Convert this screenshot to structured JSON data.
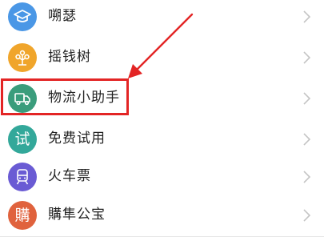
{
  "menu": {
    "items": [
      {
        "label": "嗍瑟",
        "icon": "graduation-cap-icon",
        "color": "#4a97e6"
      },
      {
        "label": "摇钱树",
        "icon": "money-tree-icon",
        "color": "#f0a52b"
      },
      {
        "label": "物流小助手",
        "icon": "delivery-truck-icon",
        "color": "#3a9d7c"
      },
      {
        "label": "免费试用",
        "icon": "trial-icon",
        "icon_text": "试",
        "color": "#33a89a"
      },
      {
        "label": "火车票",
        "icon": "train-icon",
        "color": "#6a5bd4"
      },
      {
        "label": "購隼公宝",
        "icon": "store-icon",
        "icon_text": "購",
        "color": "#e0623d"
      }
    ]
  },
  "annotation": {
    "highlight_color": "#e32525",
    "highlighted_item": "物流小助手"
  }
}
